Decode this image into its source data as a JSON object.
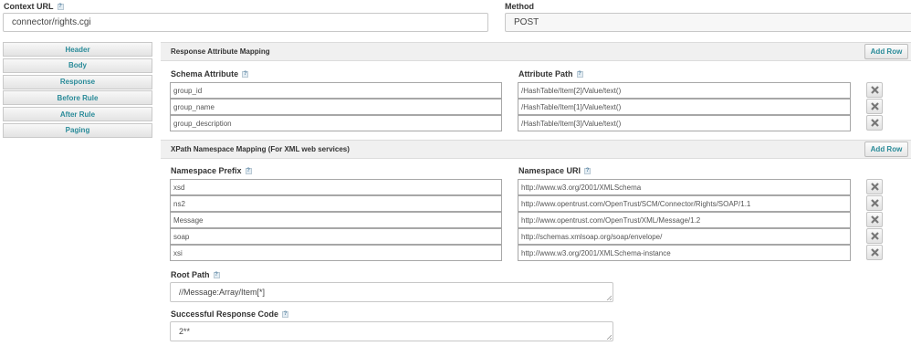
{
  "context_url": {
    "label": "Context URL",
    "value": "connector/rights.cgi"
  },
  "method": {
    "label": "Method",
    "value": "POST"
  },
  "nav": [
    {
      "label": "Header"
    },
    {
      "label": "Body"
    },
    {
      "label": "Response"
    },
    {
      "label": "Before Rule"
    },
    {
      "label": "After Rule"
    },
    {
      "label": "Paging"
    }
  ],
  "response_mapping": {
    "title": "Response Attribute Mapping",
    "add_label": "Add Row",
    "col1": "Schema Attribute",
    "col2": "Attribute Path",
    "rows": [
      {
        "attr": "group_id",
        "path": "/HashTable/Item[2]/Value/text()"
      },
      {
        "attr": "group_name",
        "path": "/HashTable/Item[1]/Value/text()"
      },
      {
        "attr": "group_description",
        "path": "/HashTable/Item[3]/Value/text()"
      }
    ]
  },
  "namespace_mapping": {
    "title": "XPath Namespace Mapping (For XML web services)",
    "add_label": "Add Row",
    "col1": "Namespace Prefix",
    "col2": "Namespace URI",
    "rows": [
      {
        "prefix": "xsd",
        "uri": "http://www.w3.org/2001/XMLSchema"
      },
      {
        "prefix": "ns2",
        "uri": "http://www.opentrust.com/OpenTrust/SCM/Connector/Rights/SOAP/1.1"
      },
      {
        "prefix": "Message",
        "uri": "http://www.opentrust.com/OpenTrust/XML/Message/1.2"
      },
      {
        "prefix": "soap",
        "uri": "http://schemas.xmlsoap.org/soap/envelope/"
      },
      {
        "prefix": "xsi",
        "uri": "http://www.w3.org/2001/XMLSchema-instance"
      }
    ]
  },
  "root_path": {
    "label": "Root Path",
    "value": "//Message:Array/Item[*]"
  },
  "success_code": {
    "label": "Successful Response Code",
    "value": "2**"
  },
  "icons": {
    "help": "help-icon",
    "delete": "delete-x-icon",
    "resize": "resize-grip-icon"
  }
}
